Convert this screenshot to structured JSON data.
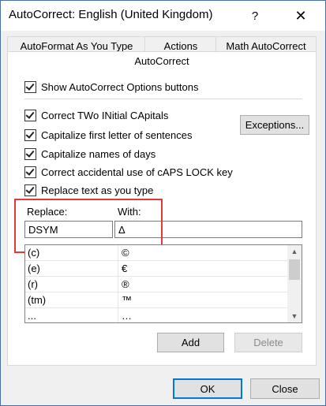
{
  "window": {
    "title": "AutoCorrect: English (United Kingdom)",
    "help_glyph": "?",
    "close_glyph": "✕"
  },
  "tabs": [
    {
      "label": "AutoFormat As You Type"
    },
    {
      "label": "Actions"
    },
    {
      "label": "Math AutoCorrect"
    },
    {
      "label": "AutoCorrect",
      "active": true
    }
  ],
  "options": {
    "show_buttons": {
      "label": "Show AutoCorrect Options buttons",
      "checked": true
    },
    "two_initial_capitals": {
      "label": "Correct TWo INitial CApitals",
      "checked": true
    },
    "capitalize_sentences": {
      "label": "Capitalize first letter of sentences",
      "checked": true
    },
    "capitalize_days": {
      "label": "Capitalize names of days",
      "checked": true
    },
    "caps_lock": {
      "label": "Correct accidental use of cAPS LOCK key",
      "checked": true
    },
    "replace_text": {
      "label": "Replace text as you type",
      "checked": true
    }
  },
  "exceptions_button": "Exceptions...",
  "replace": {
    "replace_label": "Replace:",
    "with_label": "With:",
    "replace_value": "DSYM",
    "with_value": "Δ"
  },
  "entries": [
    {
      "replace": "(c)",
      "with": "©"
    },
    {
      "replace": "(e)",
      "with": "€"
    },
    {
      "replace": "(r)",
      "with": "®"
    },
    {
      "replace": "(tm)",
      "with": "™"
    },
    {
      "replace": "...",
      "with": "…"
    }
  ],
  "buttons": {
    "add": "Add",
    "delete": "Delete",
    "ok": "OK",
    "close": "Close"
  },
  "colors": {
    "highlight": "#e03a3a",
    "focus_border": "#0078d7"
  },
  "icons": {
    "scroll_up": "▲",
    "scroll_down": "▼"
  }
}
